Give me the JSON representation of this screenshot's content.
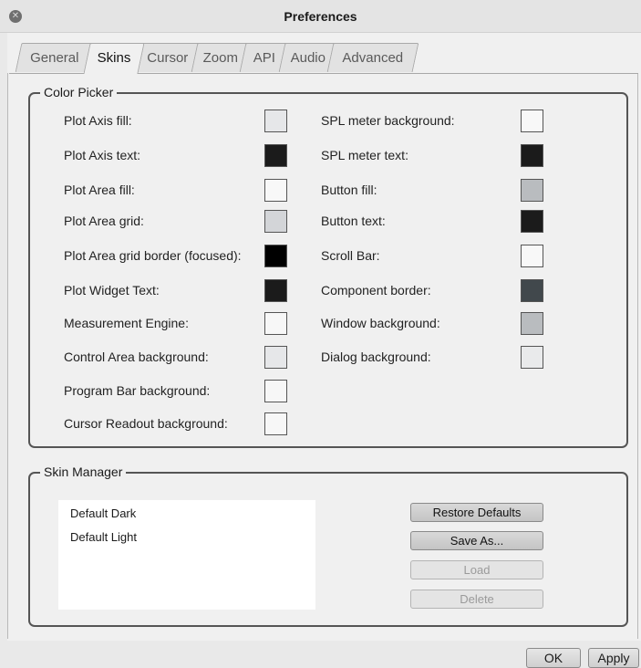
{
  "window": {
    "title": "Preferences"
  },
  "tabs": [
    "General",
    "Skins",
    "Cursor",
    "Zoom",
    "API",
    "Audio",
    "Advanced"
  ],
  "active_tab": "Skins",
  "color_picker": {
    "legend": "Color Picker",
    "left": [
      {
        "label": "Plot Axis fill:",
        "color": "#e6e7e9"
      },
      {
        "label": "Plot Axis text:",
        "color": "#1b1b1b"
      },
      {
        "label": "Plot Area fill:",
        "color": "#f8f8f8"
      },
      {
        "label": "Plot Area grid:",
        "color": "#d3d5d8"
      },
      {
        "label": "Plot Area grid border (focused):",
        "color": "#000000"
      },
      {
        "label": "Plot Widget Text:",
        "color": "#1b1b1b"
      },
      {
        "label": "Measurement Engine:",
        "color": "#f7f7f7"
      },
      {
        "label": "Control Area background:",
        "color": "#e6e7e9"
      },
      {
        "label": "Program Bar background:",
        "color": "#f7f7f7"
      },
      {
        "label": "Cursor Readout background:",
        "color": "#f7f7f7"
      }
    ],
    "right": [
      {
        "label": "SPL meter background:",
        "color": "#f8f8f8"
      },
      {
        "label": "SPL meter text:",
        "color": "#1b1b1b"
      },
      {
        "label": "Button fill:",
        "color": "#b9bcbf"
      },
      {
        "label": "Button text:",
        "color": "#1b1b1b"
      },
      {
        "label": "Scroll Bar:",
        "color": "#f8f8f8"
      },
      {
        "label": "Component border:",
        "color": "#41484c"
      },
      {
        "label": "Window background:",
        "color": "#b9bcbf"
      },
      {
        "label": "Dialog background:",
        "color": "#e9eaeb"
      }
    ]
  },
  "skin_manager": {
    "legend": "Skin Manager",
    "skins": [
      "Default Dark",
      "Default Light"
    ],
    "buttons": {
      "restore": "Restore Defaults",
      "save_as": "Save As...",
      "load": "Load",
      "delete": "Delete"
    }
  },
  "footer": {
    "ok": "OK",
    "apply": "Apply"
  }
}
